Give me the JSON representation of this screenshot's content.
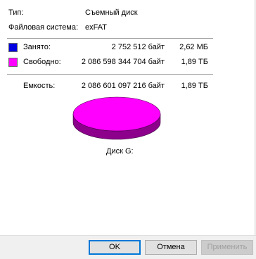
{
  "info": {
    "type_label": "Тип:",
    "type_value": "Съемный диск",
    "fs_label": "Файловая система:",
    "fs_value": "exFAT"
  },
  "usage": {
    "used": {
      "label": "Занято:",
      "bytes": "2 752 512 байт",
      "size": "2,62 МБ",
      "color": "#0000e0"
    },
    "free": {
      "label": "Свободно:",
      "bytes": "2 086 598 344 704 байт",
      "size": "1,89 ТБ",
      "color": "#ff00ff"
    },
    "capacity": {
      "label": "Емкость:",
      "bytes": "2 086 601 097 216 байт",
      "size": "1,89 ТБ"
    }
  },
  "disk_label": "Диск G:",
  "buttons": {
    "ok": "OK",
    "cancel": "Отмена",
    "apply": "Применить"
  },
  "chart_data": {
    "type": "pie",
    "slices": [
      {
        "label": "Занято",
        "value": 2752512,
        "color": "#0000e0"
      },
      {
        "label": "Свободно",
        "value": 2086598344704,
        "color": "#ff00ff"
      }
    ]
  }
}
